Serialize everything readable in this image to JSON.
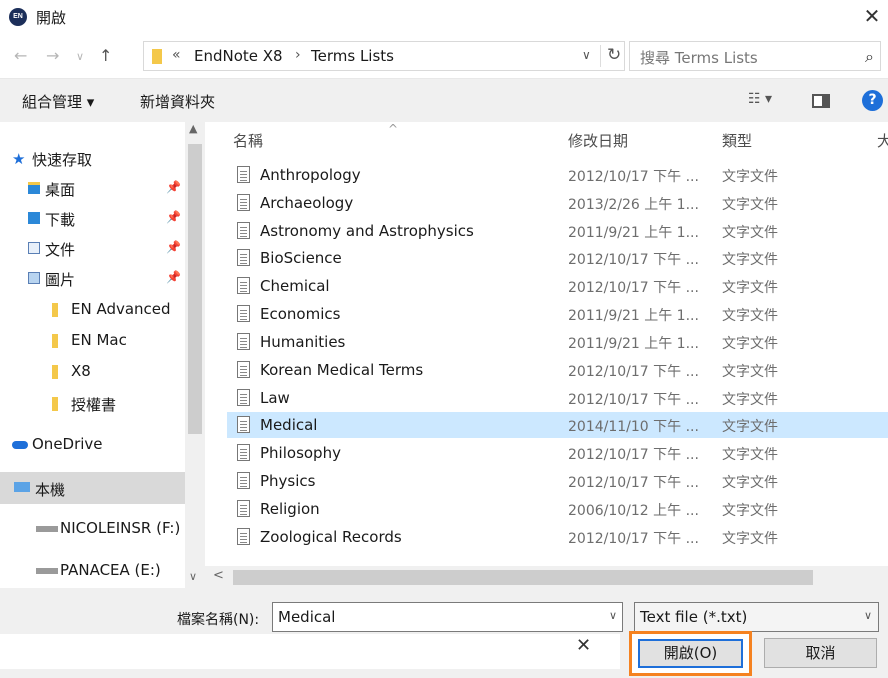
{
  "window": {
    "title": "開啟",
    "app_badge": "EN"
  },
  "address": {
    "chevron": "«",
    "crumbs": [
      "EndNote X8",
      "Terms Lists"
    ],
    "separator": "›",
    "search_placeholder": "搜尋 Terms Lists"
  },
  "toolbar": {
    "organize": "組合管理 ▾",
    "new_folder": "新增資料夾"
  },
  "nav": {
    "items": [
      {
        "label": "快速存取"
      },
      {
        "label": "桌面"
      },
      {
        "label": "下載"
      },
      {
        "label": "文件"
      },
      {
        "label": "圖片"
      },
      {
        "label": "EN Advanced"
      },
      {
        "label": "EN Mac"
      },
      {
        "label": "X8"
      },
      {
        "label": "授權書"
      },
      {
        "label": "OneDrive"
      },
      {
        "label": "本機"
      },
      {
        "label": "NICOLEINSR (F:)"
      },
      {
        "label": "PANACEA (E:)"
      }
    ]
  },
  "columns": {
    "name": "名稱",
    "date": "修改日期",
    "type": "類型",
    "size": "大"
  },
  "files": [
    {
      "name": "Anthropology",
      "date": "2012/10/17 下午 ...",
      "type": "文字文件"
    },
    {
      "name": "Archaeology",
      "date": "2013/2/26 上午 1...",
      "type": "文字文件"
    },
    {
      "name": "Astronomy and Astrophysics",
      "date": "2011/9/21 上午 1...",
      "type": "文字文件"
    },
    {
      "name": "BioScience",
      "date": "2012/10/17 下午 ...",
      "type": "文字文件"
    },
    {
      "name": "Chemical",
      "date": "2012/10/17 下午 ...",
      "type": "文字文件"
    },
    {
      "name": "Economics",
      "date": "2011/9/21 上午 1...",
      "type": "文字文件"
    },
    {
      "name": "Humanities",
      "date": "2011/9/21 上午 1...",
      "type": "文字文件"
    },
    {
      "name": "Korean Medical Terms",
      "date": "2012/10/17 下午 ...",
      "type": "文字文件"
    },
    {
      "name": "Law",
      "date": "2012/10/17 下午 ...",
      "type": "文字文件"
    },
    {
      "name": "Medical",
      "date": "2014/11/10 下午 ...",
      "type": "文字文件",
      "selected": true
    },
    {
      "name": "Philosophy",
      "date": "2012/10/17 下午 ...",
      "type": "文字文件"
    },
    {
      "name": "Physics",
      "date": "2012/10/17 下午 ...",
      "type": "文字文件"
    },
    {
      "name": "Religion",
      "date": "2006/10/12 上午 ...",
      "type": "文字文件"
    },
    {
      "name": "Zoological Records",
      "date": "2012/10/17 下午 ...",
      "type": "文字文件"
    }
  ],
  "footer": {
    "filename_label": "檔案名稱(N):",
    "filename_value": "Medical",
    "filter_value": "Text file  (*.txt)",
    "open_label": "開啟(O)",
    "cancel_label": "取消"
  },
  "colors": {
    "selection": "#cce8ff",
    "accent_blue": "#1e6fd9",
    "highlight_orange": "#f58220"
  }
}
